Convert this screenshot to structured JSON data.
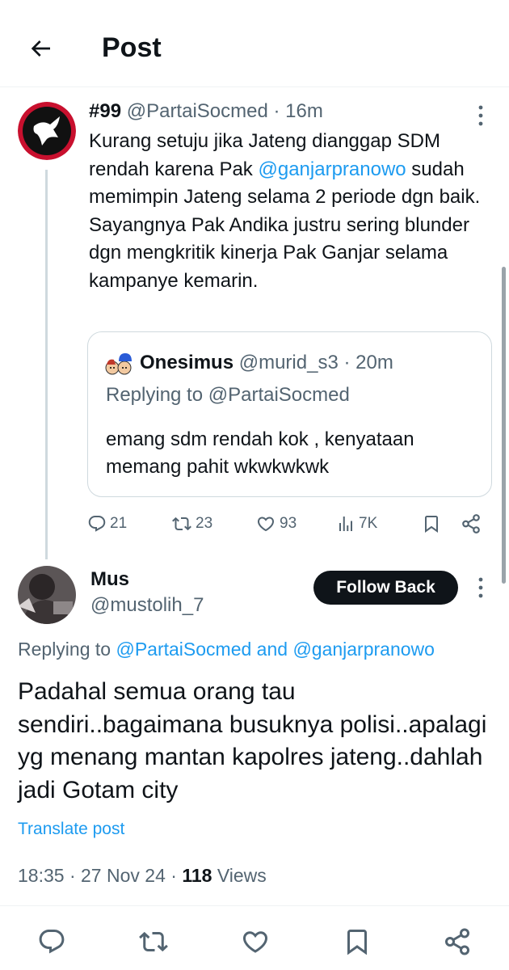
{
  "header": {
    "title": "Post",
    "back_icon": "arrow-left-icon"
  },
  "post1": {
    "number": "#99",
    "handle": "@PartaiSocmed",
    "separator": "·",
    "time": "16m",
    "text_part1": "Kurang setuju jika Jateng dianggap SDM rendah karena Pak ",
    "mention": "@ganjarpranowo",
    "text_part2": " sudah memimpin Jateng selama 2 periode dgn baik. Sayangnya Pak Andika justru sering blunder dgn mengkritik kinerja Pak Ganjar selama kampanye kemarin.",
    "quote": {
      "name": "Onesimus",
      "handle": "@murid_s3",
      "separator": "·",
      "time": "20m",
      "replying_to": "Replying to @PartaiSocmed",
      "text": "emang sdm rendah kok , kenyataan memang pahit wkwkwkwk"
    },
    "stats": {
      "replies": "21",
      "reposts": "23",
      "likes": "93",
      "views": "7K"
    }
  },
  "post2": {
    "name": "Mus",
    "handle": "@mustolih_7",
    "follow_label": "Follow Back",
    "replying_prefix": "Replying to ",
    "replying_mention1": "@PartaiSocmed",
    "replying_and": " and ",
    "replying_mention2": "@ganjarpranowo",
    "text": "Padahal semua orang tau sendiri..bagaimana busuknya polisi..apalagi yg menang mantan kapolres jateng..dahlah jadi Gotam city",
    "translate_label": "Translate post",
    "time": "18:35",
    "date": "27 Nov 24",
    "views_count": "118",
    "views_label": "Views"
  },
  "colors": {
    "link": "#1d9bf0",
    "text": "#0f1419",
    "secondary": "#536471",
    "border": "#cfd9de"
  }
}
